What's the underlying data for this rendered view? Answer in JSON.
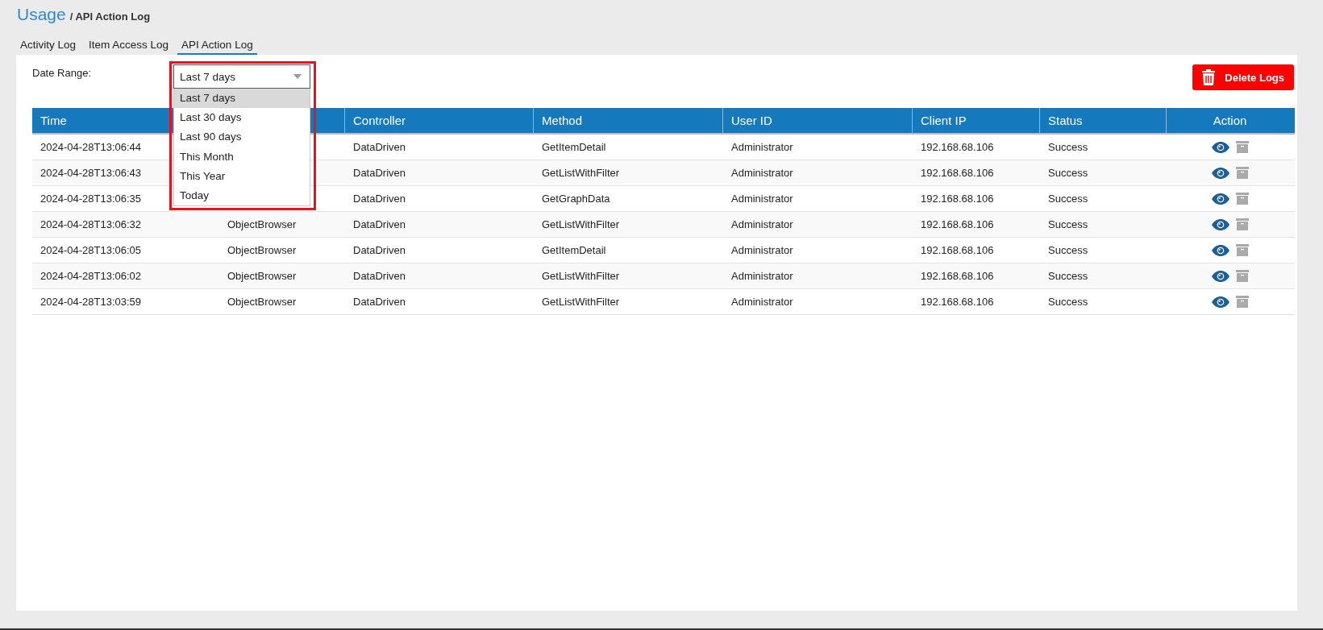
{
  "header": {
    "title": "Usage",
    "breadcrumb": "/ API Action Log"
  },
  "tabs": [
    {
      "label": "Activity Log",
      "selected": false
    },
    {
      "label": "Item Access Log",
      "selected": false
    },
    {
      "label": "API Action Log",
      "selected": true
    }
  ],
  "date_range": {
    "label": "Date Range:",
    "value": "Last 7 days",
    "expanded": true,
    "options": [
      {
        "label": "Last 7 days",
        "selected": true
      },
      {
        "label": "Last 30 days",
        "selected": false
      },
      {
        "label": "Last 90 days",
        "selected": false
      },
      {
        "label": "This Month",
        "selected": false
      },
      {
        "label": "This Year",
        "selected": false
      },
      {
        "label": "Today",
        "selected": false
      }
    ]
  },
  "delete_button": "Delete Logs",
  "table": {
    "columns": [
      "Time",
      null,
      "Controller",
      "Method",
      "User ID",
      "Client IP",
      "Status",
      "Action"
    ],
    "rows": [
      [
        "2024-04-28T13:06:44",
        null,
        "DataDriven",
        "GetItemDetail",
        "Administrator",
        "192.168.68.106",
        "Success"
      ],
      [
        "2024-04-28T13:06:43",
        null,
        "DataDriven",
        "GetListWithFilter",
        "Administrator",
        "192.168.68.106",
        "Success"
      ],
      [
        "2024-04-28T13:06:35",
        null,
        "DataDriven",
        "GetGraphData",
        "Administrator",
        "192.168.68.106",
        "Success"
      ],
      [
        "2024-04-28T13:06:32",
        "ObjectBrowser",
        "DataDriven",
        "GetListWithFilter",
        "Administrator",
        "192.168.68.106",
        "Success"
      ],
      [
        "2024-04-28T13:06:05",
        "ObjectBrowser",
        "DataDriven",
        "GetItemDetail",
        "Administrator",
        "192.168.68.106",
        "Success"
      ],
      [
        "2024-04-28T13:06:02",
        "ObjectBrowser",
        "DataDriven",
        "GetListWithFilter",
        "Administrator",
        "192.168.68.106",
        "Success"
      ],
      [
        "2024-04-28T13:03:59",
        "ObjectBrowser",
        "DataDriven",
        "GetListWithFilter",
        "Administrator",
        "192.168.68.106",
        "Success"
      ]
    ]
  }
}
